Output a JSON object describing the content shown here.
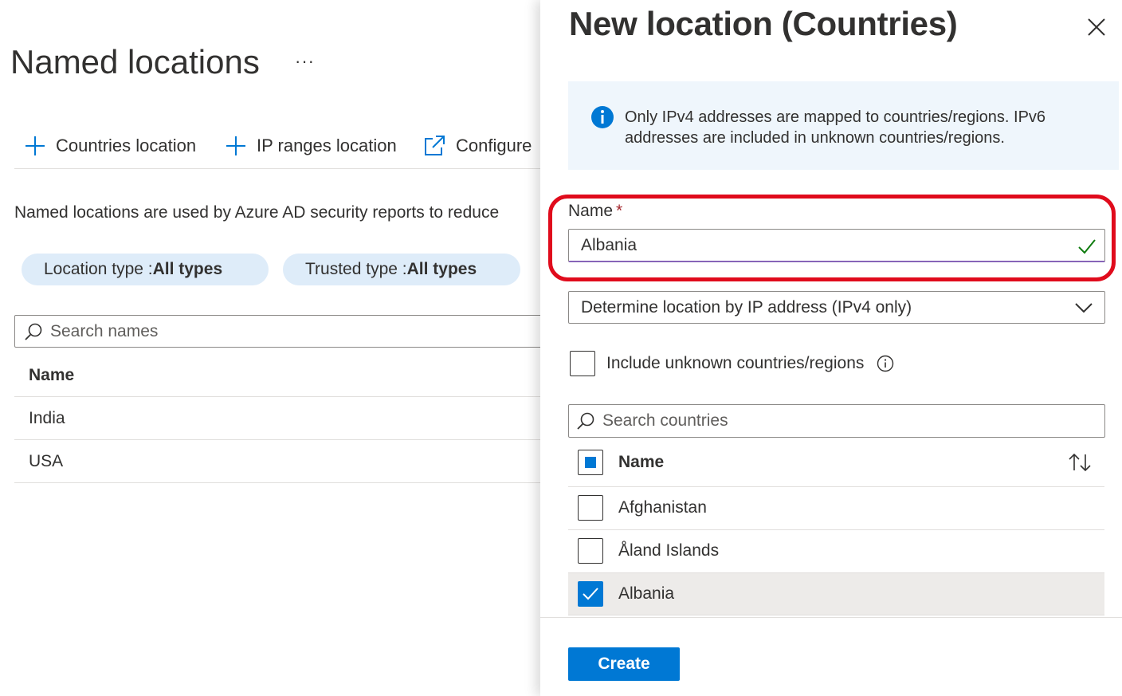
{
  "page": {
    "title": "Named locations",
    "more_label": "···",
    "toolbar": {
      "countries_label": "Countries location",
      "ip_ranges_label": "IP ranges location",
      "configure_label": "Configure"
    },
    "description": "Named locations are used by Azure AD security reports to reduce",
    "filters": [
      {
        "key": "Location type : ",
        "value": "All types"
      },
      {
        "key": "Trusted type : ",
        "value": "All types"
      }
    ],
    "search": {
      "placeholder": "Search names"
    },
    "list": {
      "header": "Name",
      "rows": [
        "India",
        "USA"
      ]
    }
  },
  "panel": {
    "title": "New location (Countries)",
    "info_text": "Only IPv4 addresses are mapped to countries/regions. IPv6 addresses are included in unknown countries/regions.",
    "name_field": {
      "label": "Name",
      "required_mark": "*",
      "value": "Albania"
    },
    "determine_select": {
      "value": "Determine location by IP address (IPv4 only)"
    },
    "include_unknown": {
      "label": "Include unknown countries/regions",
      "checked": false
    },
    "country_search": {
      "placeholder": "Search countries"
    },
    "grid": {
      "header": "Name",
      "rows": [
        {
          "name": "Afghanistan",
          "checked": false
        },
        {
          "name": "Åland Islands",
          "checked": false
        },
        {
          "name": "Albania",
          "checked": true
        }
      ]
    },
    "create_label": "Create"
  },
  "colors": {
    "accent": "#0078d4",
    "highlight_ring": "#e00b1c",
    "info_bg": "#eff6fc",
    "pill_bg": "#deecf9",
    "valid_check": "#107c10"
  },
  "icons": [
    "plus-icon",
    "external-link-icon",
    "search-icon",
    "info-icon",
    "close-icon",
    "chevron-down-icon",
    "checkmark-icon",
    "sort-icon",
    "info-circle-icon"
  ]
}
